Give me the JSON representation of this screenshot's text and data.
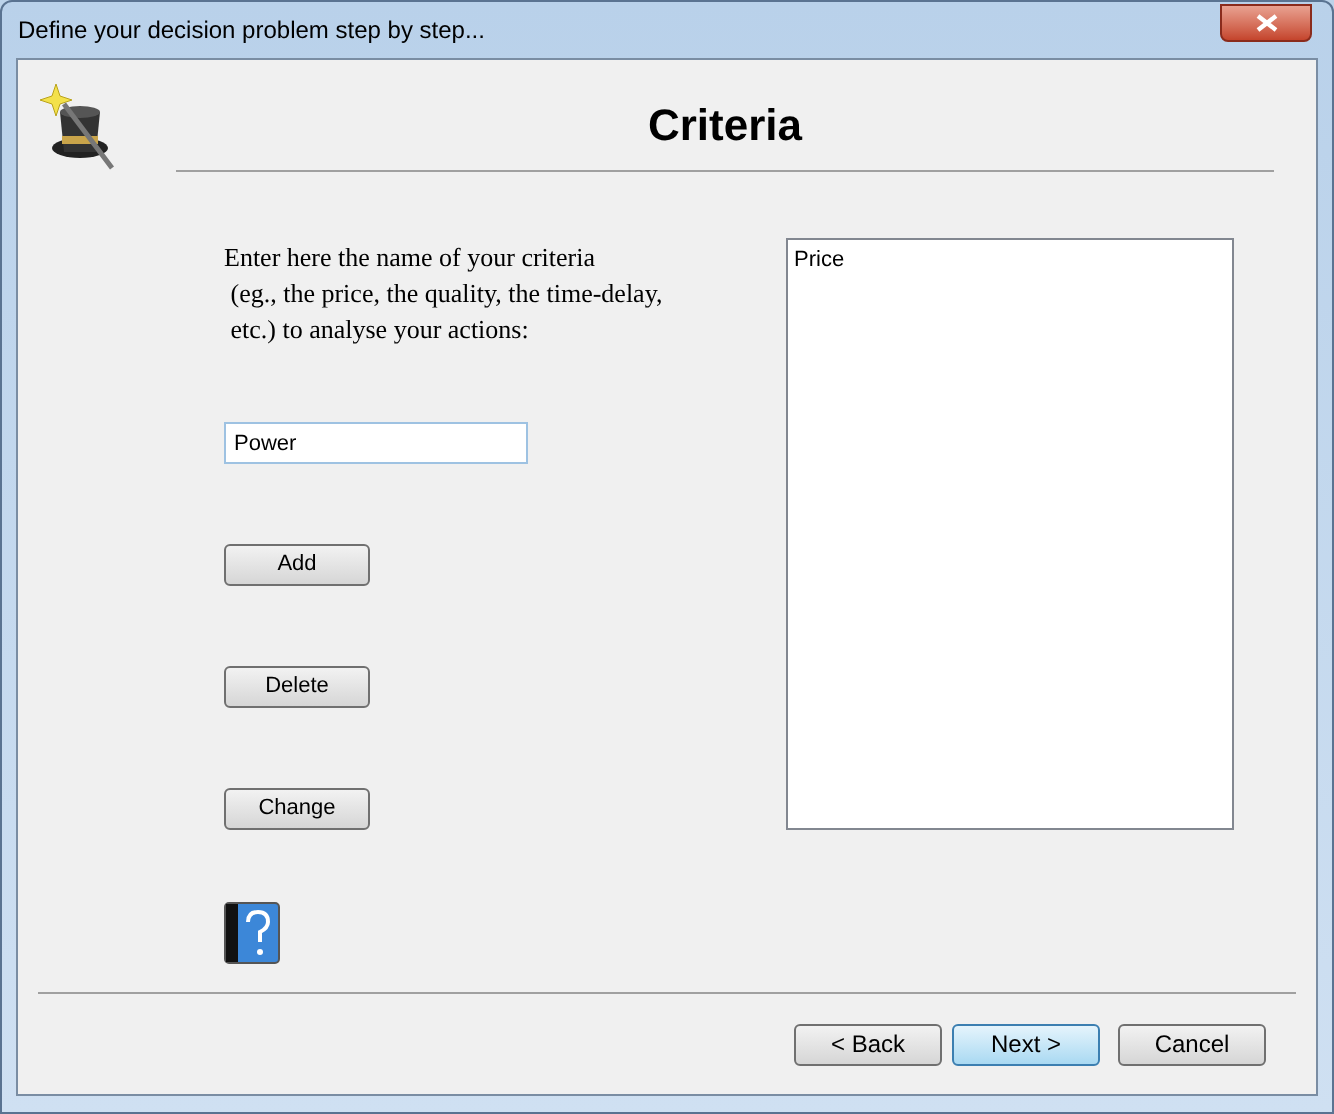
{
  "window": {
    "title": "Define your decision problem step by step..."
  },
  "header": {
    "title": "Criteria"
  },
  "instructions": "Enter here the name of your criteria\n (eg., the price, the quality, the time-delay,\n etc.) to analyse your actions:",
  "criterion_field": {
    "value": "Power"
  },
  "actions": [
    "Add",
    "Delete",
    "Change"
  ],
  "criteria_list": [
    {
      "label": "Price",
      "selected": false
    }
  ],
  "footer_buttons": [
    {
      "label": "< Back",
      "selected": false
    },
    {
      "label": "Next >",
      "selected": true
    },
    {
      "label": "Cancel",
      "selected": false
    }
  ]
}
